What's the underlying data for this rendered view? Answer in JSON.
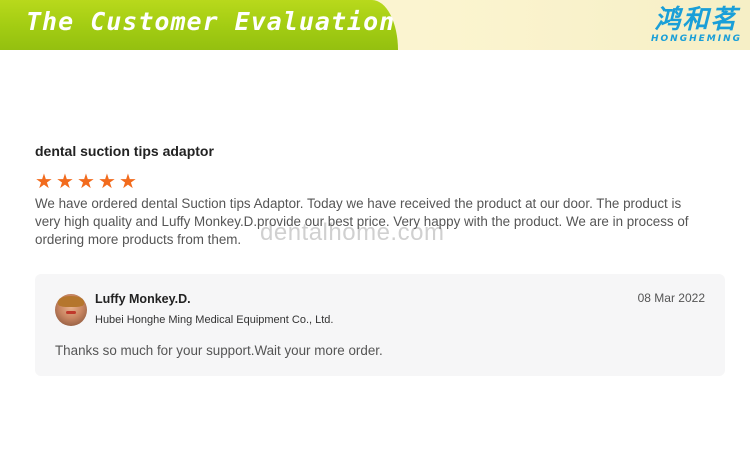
{
  "banner": {
    "title": "The Customer Evaluation",
    "brand_cn": "鸿和茗",
    "brand_en": "HONGHEMING"
  },
  "review": {
    "product_name": "dental suction tips adaptor",
    "rating": 5,
    "rating_max": 5,
    "star_icon": "★",
    "text": "We have ordered dental Suction tips Adaptor. Today we have received the product at our door. The product is very high quality and Luffy Monkey.D.provide our best price. Very happy with the product. We are in process of ordering more products from them."
  },
  "watermark": "dentalhome.com",
  "reply": {
    "name": "Luffy Monkey.D.",
    "company": "Hubei Honghe Ming Medical Equipment Co., Ltd.",
    "date": "08 Mar 2022",
    "text": "Thanks so much for your support.Wait your more order."
  },
  "colors": {
    "banner_green": "#a2cc12",
    "brand_blue": "#1a9fd8",
    "star_orange": "#f26b1d",
    "reply_bg": "#f6f6f7"
  }
}
